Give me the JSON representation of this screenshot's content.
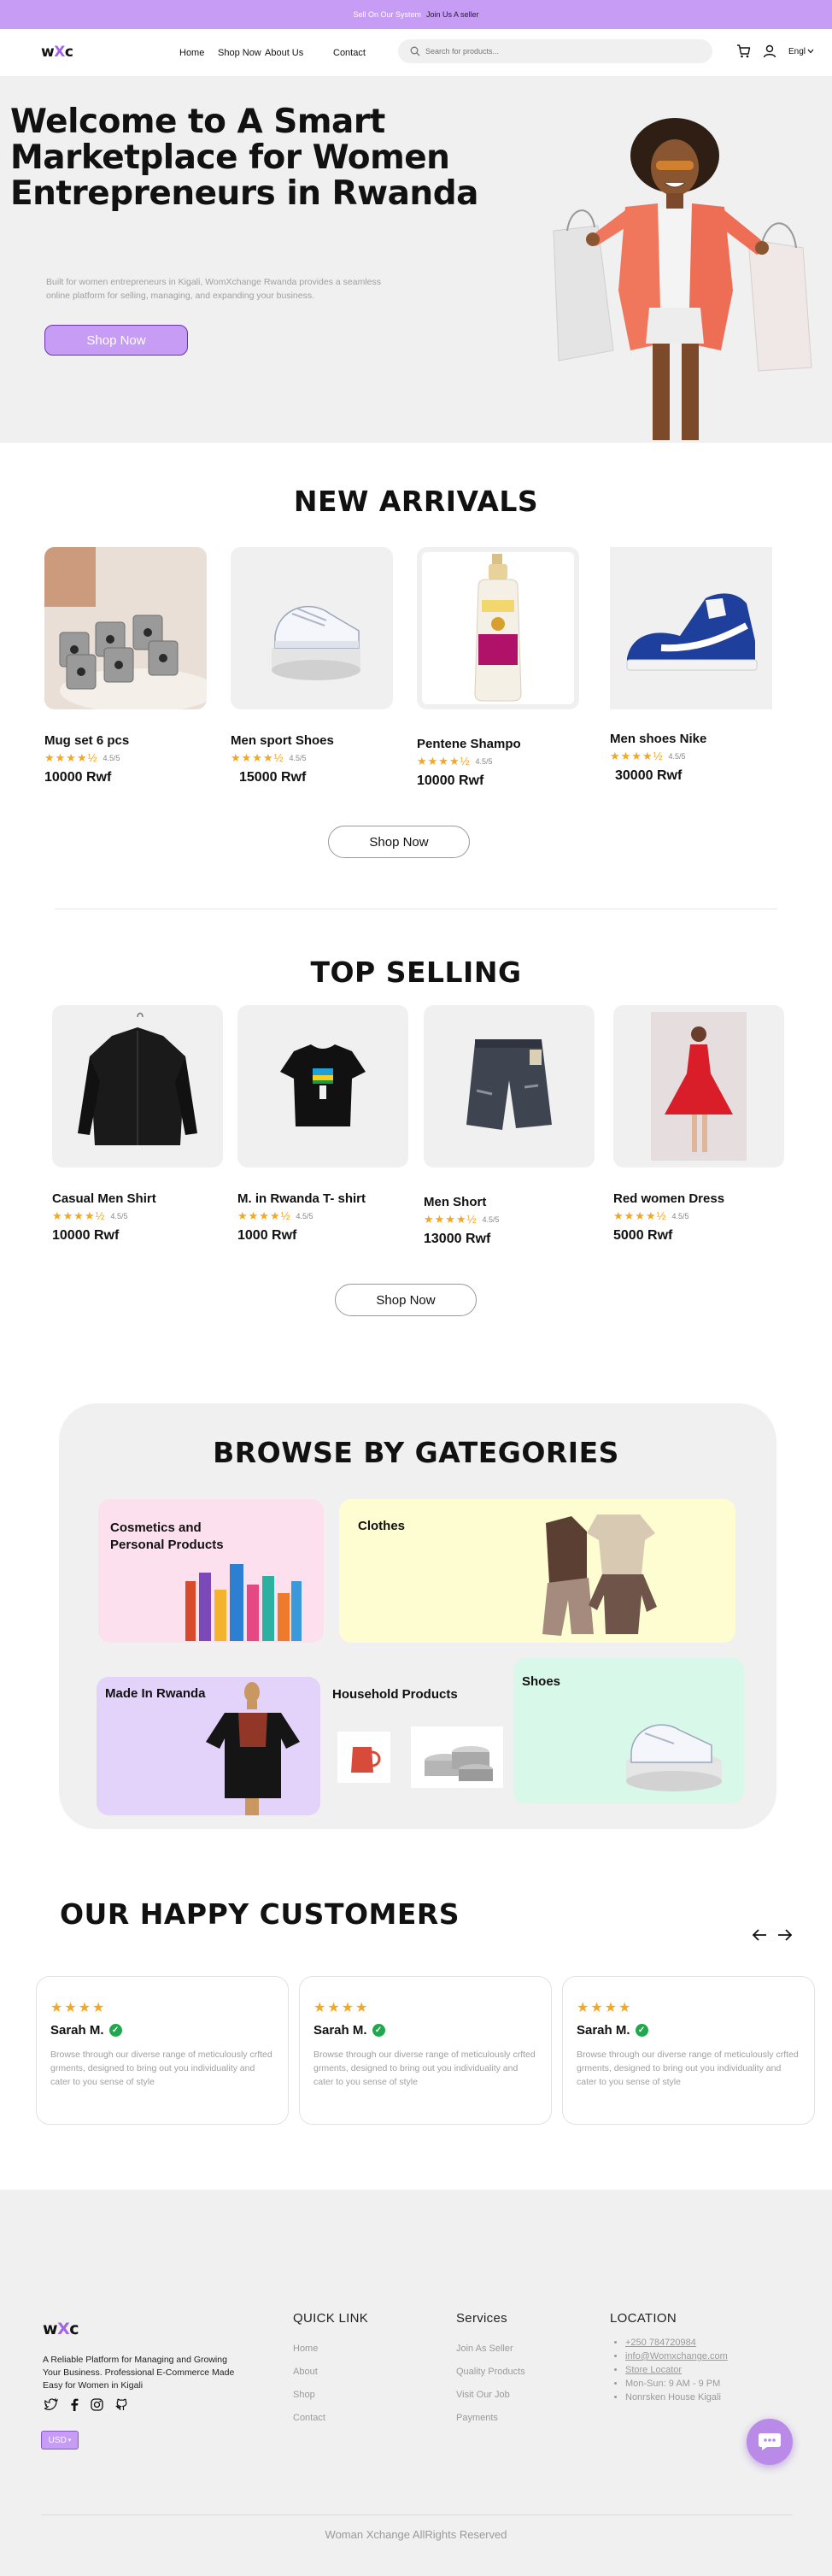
{
  "promo": {
    "text": "Sell On Our System",
    "link": "Join Us A seller"
  },
  "nav": {
    "logo_pre": "w",
    "logo_x": "X",
    "logo_post": "c",
    "links": [
      "Home",
      "Shop Now",
      "About Us",
      "Contact"
    ],
    "search_placeholder": "Search for products...",
    "language": "Engl"
  },
  "hero": {
    "title": "Welcome to A Smart Marketplace for Women Entrepreneurs in Rwanda",
    "description": "Built for women entrepreneurs in Kigali, WomXchange Rwanda provides a seamless online platform for selling, managing, and expanding your business.",
    "cta": "Shop Now"
  },
  "new_arrivals": {
    "title": "NEW ARRIVALS",
    "button": "Shop Now",
    "products": [
      {
        "name": "Mug  set 6 pcs",
        "rating": "4.5/5",
        "price": "10000 Rwf",
        "rating_value": 4.5
      },
      {
        "name": "Men sport Shoes",
        "rating": "4.5/5",
        "price": "15000 Rwf",
        "rating_value": 4.5
      },
      {
        "name": "Pentene Shampo",
        "rating": "4.5/5",
        "price": "10000 Rwf",
        "rating_value": 4.5
      },
      {
        "name": "Men shoes Nike",
        "rating": "4.5/5",
        "price": "30000 Rwf",
        "rating_value": 4.5
      }
    ]
  },
  "top_selling": {
    "title": "TOP SELLING",
    "button": "Shop Now",
    "products": [
      {
        "name": "Casual Men Shirt",
        "rating": "4.5/5",
        "price": "10000 Rwf",
        "rating_value": 4.5
      },
      {
        "name": "M. in Rwanda T- shirt",
        "rating": "4.5/5",
        "price": "1000 Rwf",
        "rating_value": 4.5
      },
      {
        "name": "Men Short",
        "rating": "4.5/5",
        "price": "13000 Rwf",
        "rating_value": 4.5
      },
      {
        "name": "Red women Dress",
        "rating": "4.5/5",
        "price": "5000 Rwf",
        "rating_value": 4.5
      }
    ]
  },
  "categories": {
    "title": "BROWSE BY GATEGORIES",
    "items": [
      "Cosmetics and Personal Products",
      "Clothes",
      "Made In Rwanda",
      "Household Products",
      "Shoes"
    ]
  },
  "customers": {
    "title": "OUR HAPPY CUSTOMERS",
    "reviews": [
      {
        "stars": 4,
        "name": "Sarah M.",
        "text": "Browse through our diverse range of meticulously crfted grments, designed to bring out you individuality and cater to you sense of style"
      },
      {
        "stars": 4,
        "name": "Sarah M.",
        "text": "Browse through our diverse range of meticulously crfted grments, designed to bring out you individuality and cater to you sense of style"
      },
      {
        "stars": 4,
        "name": "Sarah M.",
        "text": "Browse through our diverse range of meticulously crfted grments, designed to bring out you individuality and cater to you sense of style"
      }
    ]
  },
  "footer": {
    "logo_pre": "w",
    "logo_x": "X",
    "logo_post": "c",
    "tagline": "A Reliable Platform for Managing and Growing Your Business. Professional E-Commerce Made Easy for Women in Kigali",
    "currency": "USD",
    "quick_link": {
      "title": "QUICK LINK",
      "items": [
        "Home",
        "About",
        "Shop",
        "Contact"
      ]
    },
    "services": {
      "title": "Services",
      "items": [
        "Join As Seller",
        "Quality Products",
        "Visit Our Job",
        "Payments"
      ]
    },
    "location": {
      "title": "LOCATION",
      "items": [
        "+250 784720984",
        "info@Womxchange.com",
        "Store Locator",
        "Mon-Sun: 9 AM - 9 PM",
        "Nonrsken House Kigali"
      ]
    },
    "copyright": "Woman Xchange AllRights Reserved"
  },
  "colors": {
    "accent": "#c69cf5",
    "accent_dark": "#6b35b0",
    "star": "#f5a623",
    "panel": "#f0f0f0",
    "verified": "#21a84f"
  },
  "icons": [
    "search-icon",
    "cart-icon",
    "user-icon",
    "chevron-down-icon",
    "star-icon",
    "check-icon",
    "arrow-left-icon",
    "arrow-right-icon",
    "twitter-icon",
    "facebook-icon",
    "instagram-icon",
    "github-icon",
    "chat-icon"
  ]
}
